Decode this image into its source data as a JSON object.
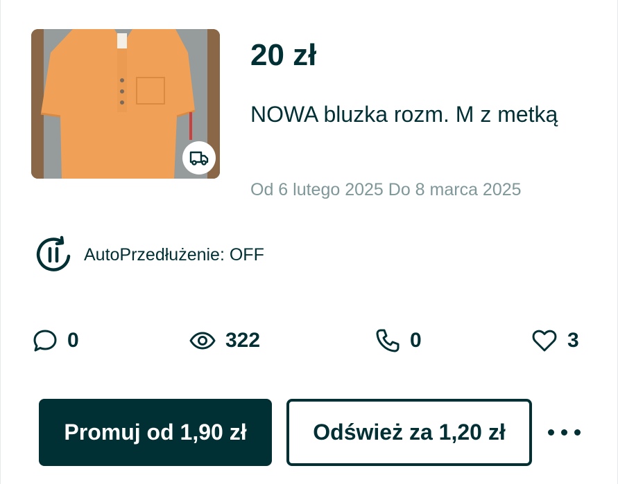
{
  "listing": {
    "price": "20 zł",
    "title": "NOWA bluzka rozm. M z metką",
    "dates": "Od 6 lutego 2025 Do 8 marca 2025",
    "image_icon": "delivery-truck-icon"
  },
  "auto_extension": {
    "label": "AutoPrzedłużenie: OFF",
    "icon": "pause-cycle-icon"
  },
  "stats": {
    "messages": {
      "icon": "chat-bubble-icon",
      "value": "0"
    },
    "views": {
      "icon": "eye-icon",
      "value": "322"
    },
    "calls": {
      "icon": "phone-icon",
      "value": "0"
    },
    "favorites": {
      "icon": "heart-icon",
      "value": "3"
    }
  },
  "actions": {
    "promote_label": "Promuj od 1,90 zł",
    "refresh_label": "Odśwież za 1,20 zł",
    "more_icon": "more-dots-icon"
  },
  "colors": {
    "primary": "#002f34",
    "muted_text": "#7f9799",
    "background": "#ffffff"
  }
}
